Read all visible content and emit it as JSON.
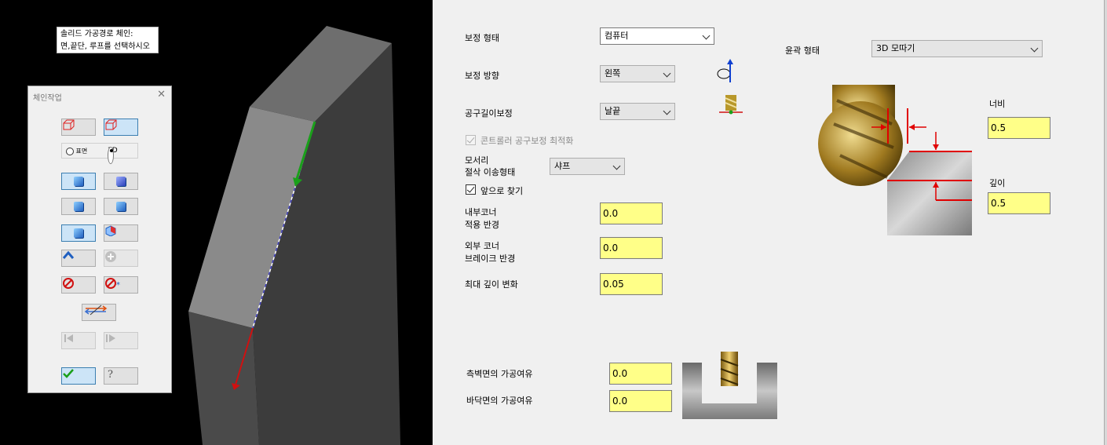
{
  "viewport": {
    "hint_line1": "솔리드 가공경로 체인:",
    "hint_line2": "면,끝단, 루프를 선택하시오"
  },
  "chain_dialog": {
    "title": "체인작업",
    "close": "✕",
    "radio_surface": "표면",
    "radio_3d": "3D",
    "radio_selected": "3D"
  },
  "form": {
    "comp_type_label": "보정 형태",
    "comp_type_value": "컴퓨터",
    "comp_dir_label": "보정 방향",
    "comp_dir_value": "왼쪽",
    "tip_comp_label": "공구길이보정",
    "tip_comp_value": "날끝",
    "optimize_label": "콘트롤러 공구보정 최적화",
    "optimize_checked": true,
    "corner_label_1": "모서리",
    "corner_label_2": "절삭 이송형태",
    "corner_value": "샤프",
    "search_label": "앞으로 찾기",
    "search_checked": true,
    "inner_corner_label_1": "내부코너",
    "inner_corner_label_2": "적용 반경",
    "inner_corner_value": "0.0",
    "outer_corner_label_1": "외부 코너",
    "outer_corner_label_2": "브레이크 반경",
    "outer_corner_value": "0.0",
    "max_depth_label": "최대 깊이 변화",
    "max_depth_value": "0.05",
    "wall_stock_label": "측벽면의 가공여유",
    "wall_stock_value": "0.0",
    "floor_stock_label": "바닥면의 가공여유",
    "floor_stock_value": "0.0",
    "contour_type_label": "윤곽 형태",
    "contour_type_value": "3D 모따기",
    "width_label": "너비",
    "width_value": "0.5",
    "depth_label": "깊이",
    "depth_value": "0.5"
  },
  "colors": {
    "input_yellow": "#ffff88",
    "dimension_red": "#e00000",
    "arrow_green": "#1aa01a"
  }
}
